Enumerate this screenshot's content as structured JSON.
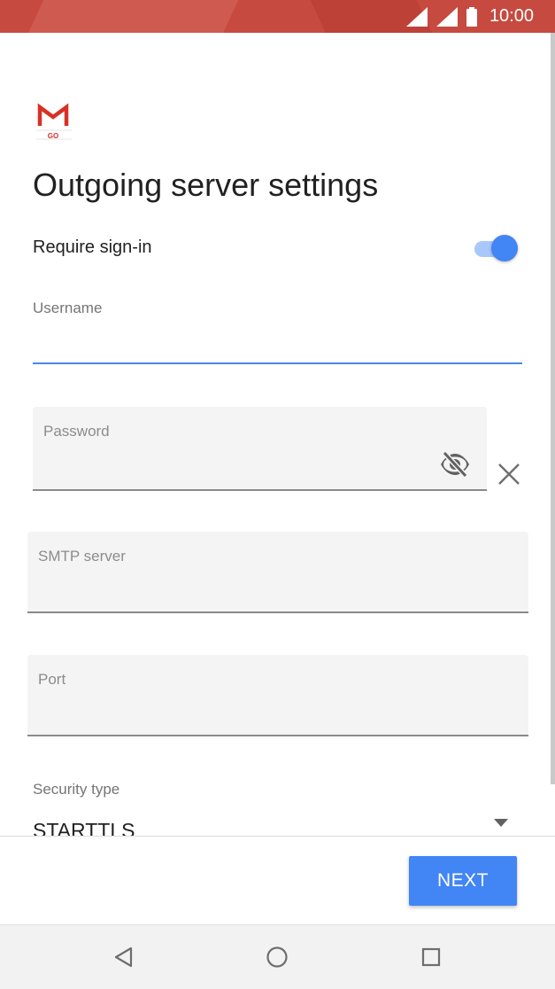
{
  "status_bar": {
    "time": "10:00",
    "icons": [
      "signal-icon",
      "signal-icon",
      "battery-icon"
    ]
  },
  "app": {
    "logo_text": "GO",
    "logo_icon": "gmail-logo-icon"
  },
  "page": {
    "title": "Outgoing server settings"
  },
  "require_signin": {
    "label": "Require sign-in",
    "enabled": true
  },
  "username": {
    "label": "Username",
    "value": ""
  },
  "password": {
    "label": "Password",
    "value": "",
    "visibility_icon": "eye-off-icon",
    "clear_icon": "close-icon"
  },
  "smtp_server": {
    "label": "SMTP server",
    "value": ""
  },
  "port": {
    "label": "Port",
    "value": ""
  },
  "security_type": {
    "label": "Security type",
    "value": "STARTTLS"
  },
  "actions": {
    "next_label": "NEXT"
  },
  "nav": {
    "back": "back-icon",
    "home": "home-icon",
    "recents": "recents-icon"
  },
  "colors": {
    "status_bar": "#c64a3f",
    "accent": "#4285f4",
    "toggle_track": "#a8c7fa"
  }
}
